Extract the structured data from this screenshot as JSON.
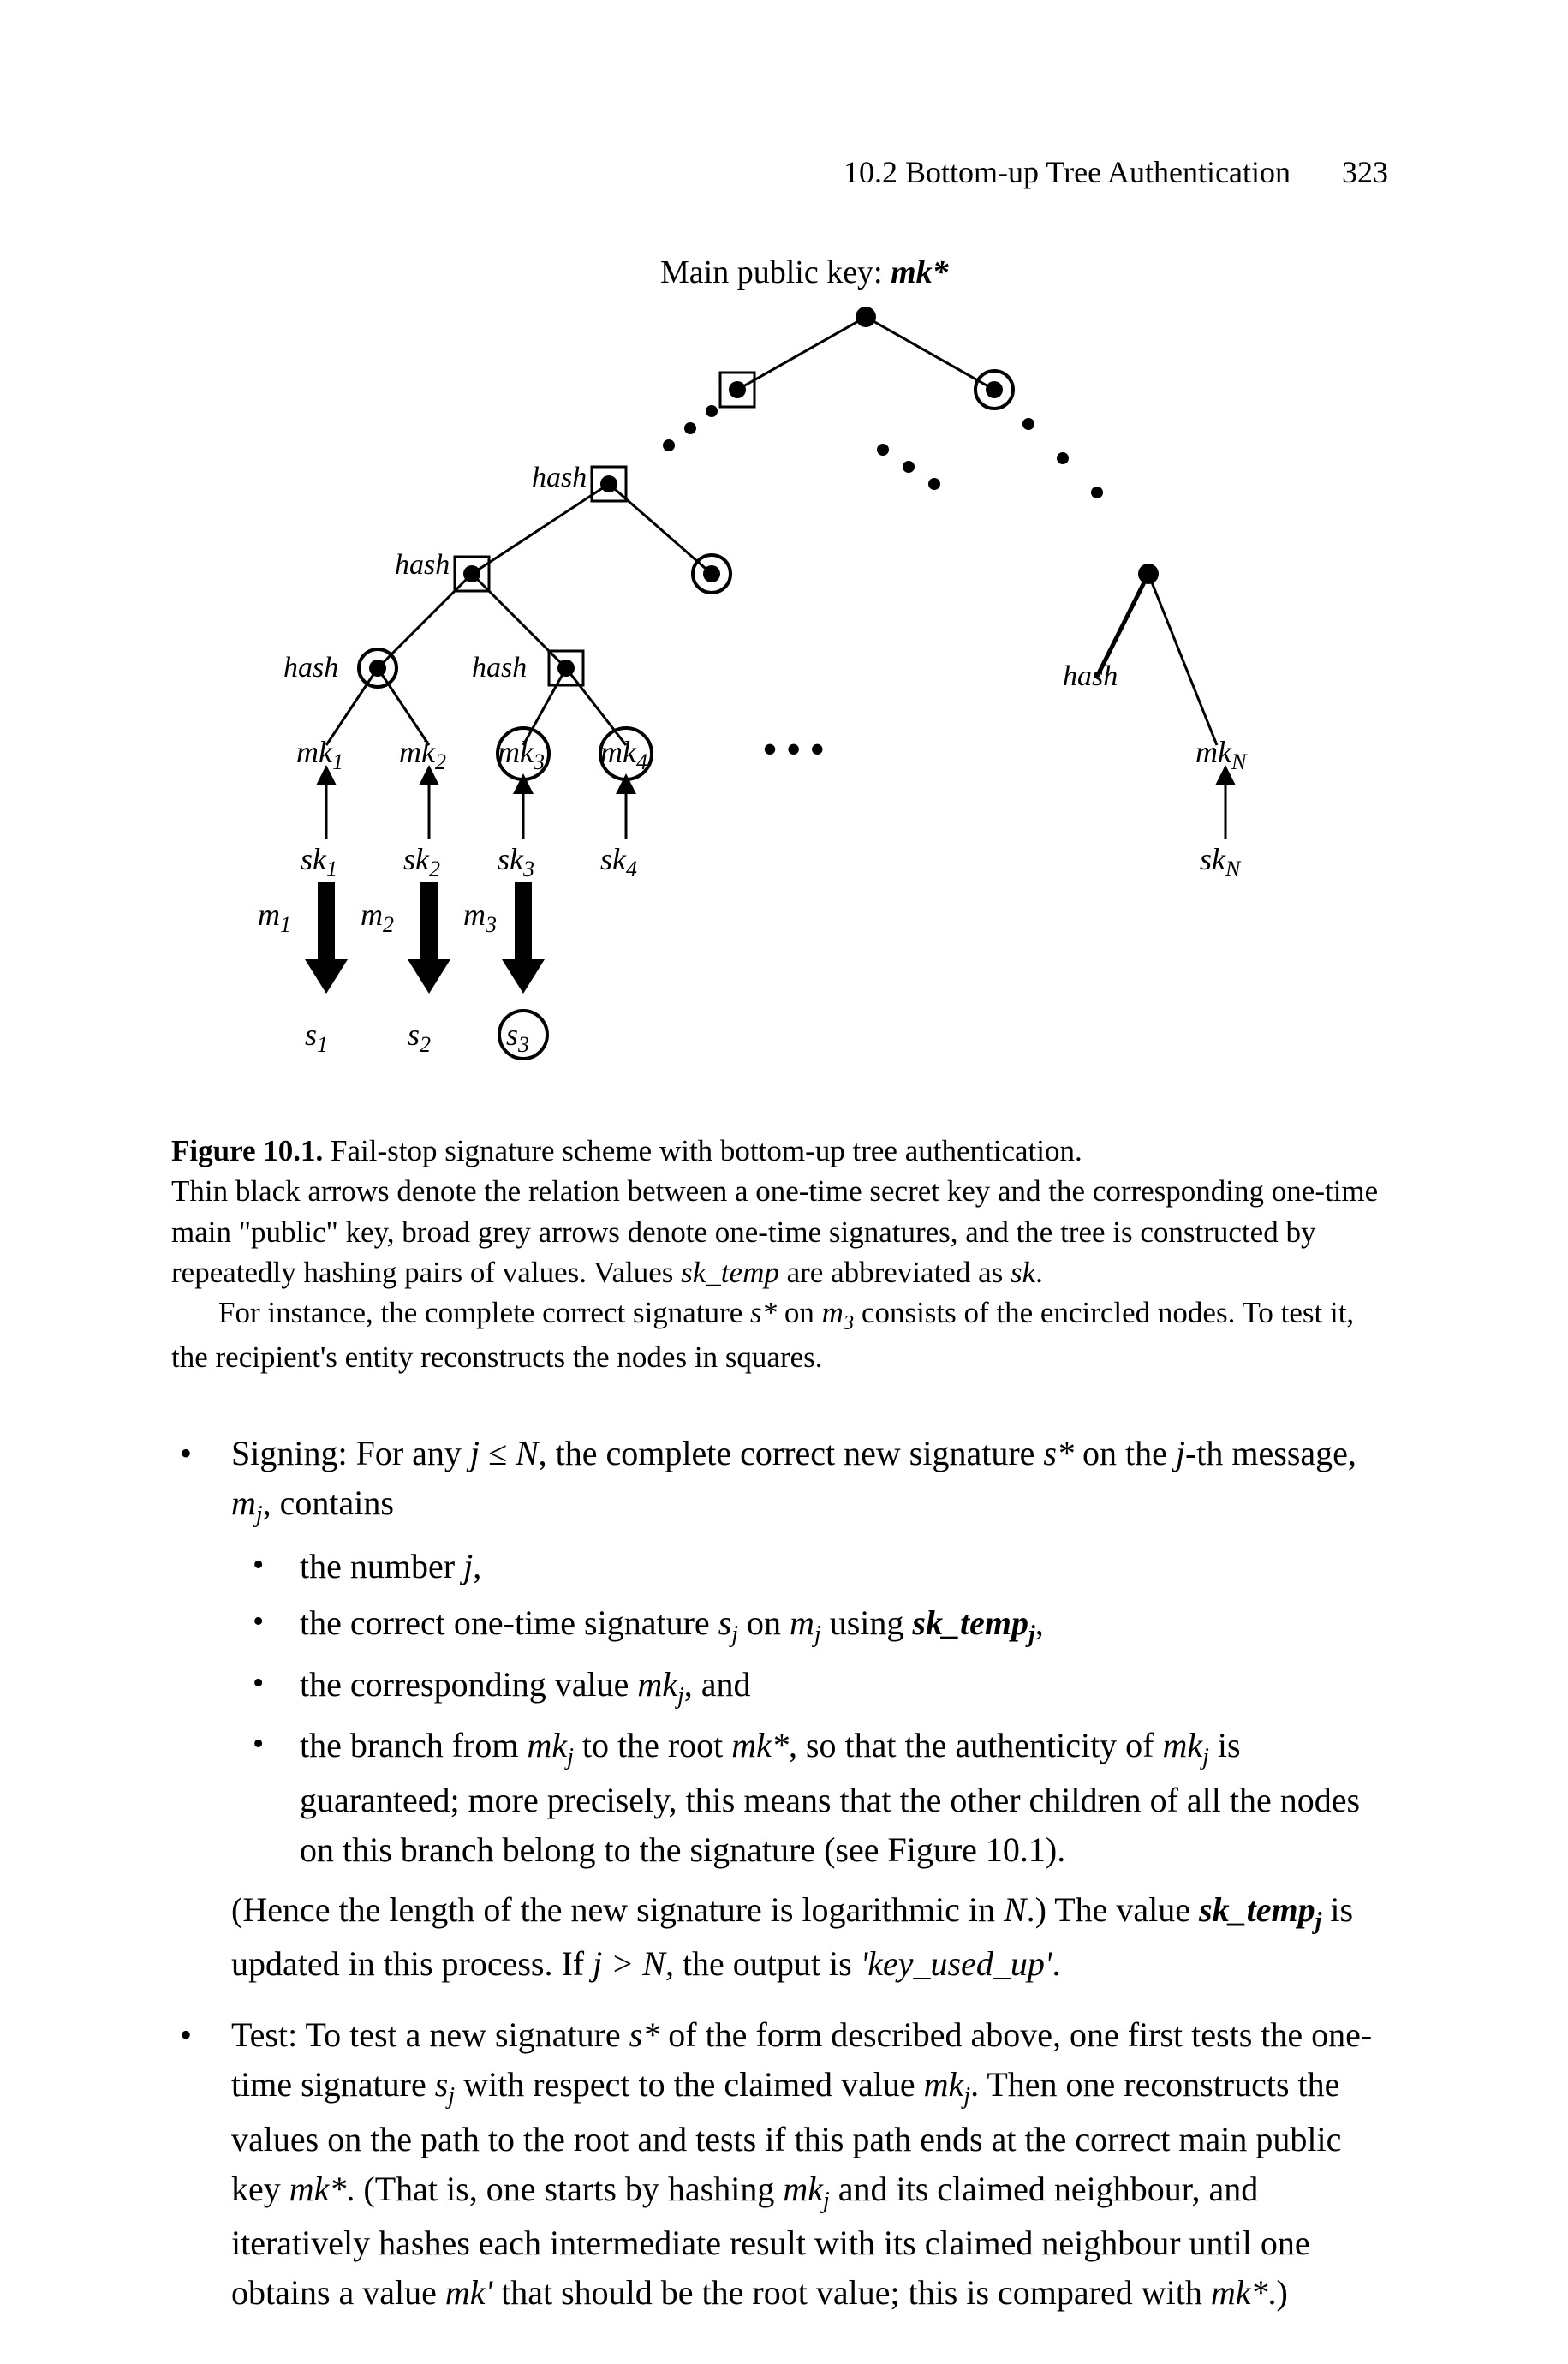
{
  "header": {
    "section": "10.2  Bottom-up Tree Authentication",
    "pageNumber": "323"
  },
  "figure": {
    "title_prefix": "Main public key: ",
    "title_mk": "mk*",
    "hash": "hash",
    "mk1": "mk",
    "mk2": "mk",
    "mk3": "mk",
    "mk4": "mk",
    "mkN": "mk",
    "mk1s": "1",
    "mk2s": "2",
    "mk3s": "3",
    "mk4s": "4",
    "mkNs": "N",
    "sk1": "sk",
    "sk2": "sk",
    "sk3": "sk",
    "sk4": "sk",
    "skN": "sk",
    "sk1s": "1",
    "sk2s": "2",
    "sk3s": "3",
    "sk4s": "4",
    "skNs": "N",
    "m1": "m",
    "m2": "m",
    "m3": "m",
    "m1s": "1",
    "m2s": "2",
    "m3s": "3",
    "s1": "s",
    "s2": "s",
    "s3": "s",
    "s1s": "1",
    "s2s": "2",
    "s3s": "3",
    "ellipsis": "• • •"
  },
  "caption": {
    "line1a": "Figure 10.1.",
    "line1b": " Fail-stop signature scheme with bottom-up tree authentication.",
    "line2": "Thin black arrows denote the relation between a one-time secret key and the corresponding one-time main \"public\" key, broad grey arrows denote one-time signatures, and the tree is constructed by repeatedly hashing pairs of values. Values ",
    "sk_temp": "sk_temp",
    "line2b": " are abbreviated as ",
    "sk": "sk",
    "dot": ".",
    "line3a": "For instance, the complete correct signature ",
    "sstar": "s*",
    "line3b": " on ",
    "m3lbl": "m",
    "m3sub": "3",
    "line3c": " consists of the encircled nodes. To test it, the recipient's entity reconstructs the nodes in squares."
  },
  "body": {
    "signing": {
      "lead_a": "Signing: For any ",
      "j_le_N": "j ≤ N",
      "lead_b": ", the complete correct new signature ",
      "sstar": "s*",
      "lead_c": " on the ",
      "j_th": "j",
      "lead_d": "-th message, ",
      "mj": "m",
      "mj_sub": "j",
      "lead_e": ", contains",
      "bullet1a": "the number ",
      "bullet1b": "j",
      "bullet1c": ",",
      "bullet2a": "the correct one-time signature ",
      "bullet2_sj": "s",
      "bullet2_sjsub": "j",
      "bullet2b": " on ",
      "bullet2_mj": "m",
      "bullet2_mjsub": "j",
      "bullet2c": " using ",
      "bullet2_sktemp": "sk_temp",
      "bullet2_sktempsub": "j",
      "bullet2d": ",",
      "bullet3a": "the corresponding value ",
      "bullet3_mk": "mk",
      "bullet3_mksub": "j",
      "bullet3b": ", and",
      "bullet4a": "the branch from ",
      "bullet4_mkj": "mk",
      "bullet4_mkjsub": "j",
      "bullet4b": " to the root ",
      "bullet4_mkstar": "mk*",
      "bullet4c": ", so that the authenticity of ",
      "bullet4_mkj2": "mk",
      "bullet4_mkj2sub": "j",
      "bullet4d": " is guaranteed; more precisely, this means that the other children of all the nodes on this branch belong to the signature (see Figure 10.1).",
      "aftera": "(Hence the length of the new signature is logarithmic in ",
      "after_N": "N",
      "afterb": ".) The value ",
      "after_sktemp": "sk_temp",
      "after_sktempsub": "j",
      "afterc": " is updated in this process. If ",
      "after_jN": "j > N",
      "afterd": ", the output is ",
      "after_keyused": "'key_used_up'",
      "aftere": "."
    },
    "test": {
      "a": "Test: To test a new signature ",
      "sstar": "s*",
      "b": " of the form described above, one first tests the one-time signature ",
      "sj": "s",
      "sjsub": "j",
      "c": " with respect to the claimed value ",
      "mkj": "mk",
      "mkjsub": "j",
      "d": ". Then one reconstructs the values on the path to the root and tests if this path ends at the correct main public key ",
      "mkstar": "mk*",
      "e": ". (That is, one starts by hashing ",
      "mkj2": "mk",
      "mkj2sub": "j",
      "f": " and its claimed neighbour, and iteratively hashes each intermediate result with its claimed neighbour until one obtains a value ",
      "mkprime": "mk'",
      "g": " that should be the root value; this is compared with ",
      "mkstar2": "mk*",
      "h": ".)"
    }
  }
}
